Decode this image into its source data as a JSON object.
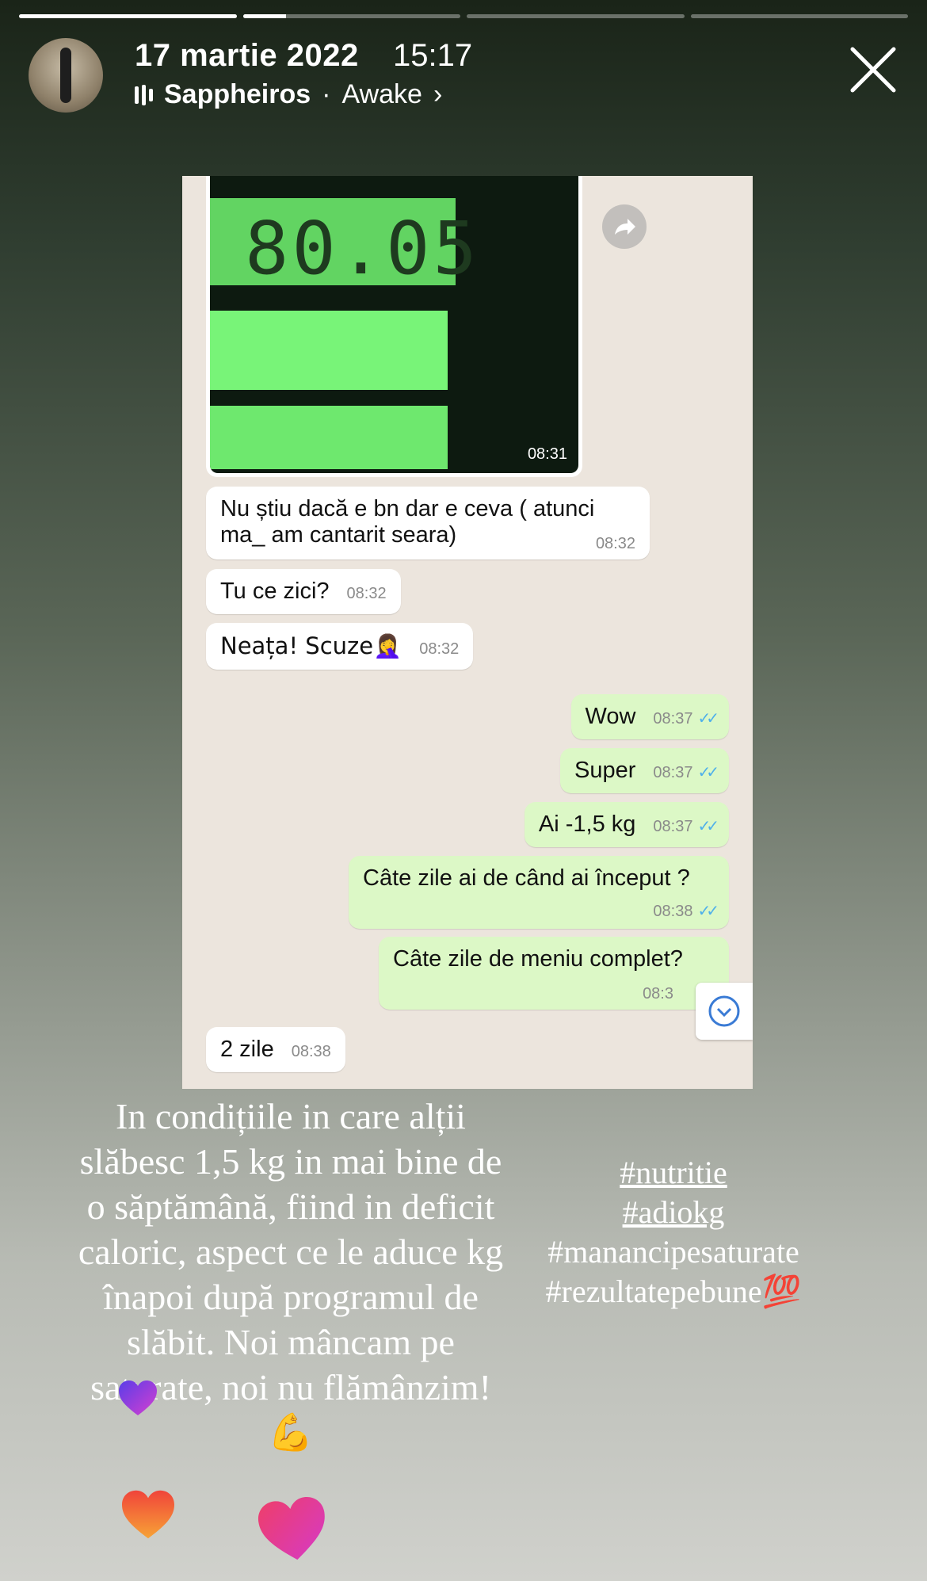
{
  "story": {
    "segments": [
      1,
      0.2,
      0,
      0
    ],
    "date": "17 martie 2022",
    "time": "15:17",
    "artist": "Sappheiros",
    "separator": "·",
    "song": "Awake",
    "chevron": "›"
  },
  "chat": {
    "scale_reading": "80.05",
    "photo_time": "08:31",
    "messages": [
      {
        "text": "Nu știu dacă e bn dar e ceva ( atunci ma_ am cantarit seara)",
        "time": "08:32",
        "dir": "in"
      },
      {
        "text": "Tu ce zici?",
        "time": "08:32",
        "dir": "in"
      },
      {
        "text": "Neața! Scuze🤦‍♀️",
        "time": "08:32",
        "dir": "in"
      },
      {
        "text": "Wow",
        "time": "08:37",
        "dir": "out"
      },
      {
        "text": "Super",
        "time": "08:37",
        "dir": "out"
      },
      {
        "text": "Ai -1,5 kg",
        "time": "08:37",
        "dir": "out"
      },
      {
        "text": "Câte zile ai de când ai început ?",
        "time": "08:38",
        "dir": "out"
      },
      {
        "text": "Câte zile de meniu complet?",
        "time": "08:3",
        "dir": "out"
      },
      {
        "text": "2 zile",
        "time": "08:38",
        "dir": "in"
      }
    ],
    "read_tick": "✓✓"
  },
  "caption": {
    "text": "In condițiile in care alții slăbesc 1,5 kg in mai bine de o săptămână, fiind in deficit caloric, aspect ce le aduce kg înapoi după programul de slăbit. Noi mâncam pe saturate, noi nu flămânzim!",
    "emoji": "💪"
  },
  "hashtags": [
    "#nutritie",
    "#adiokg",
    "#manancipesaturate",
    "#rezultatepebune💯"
  ],
  "colors": {
    "bubble_out": "#dcf8c6",
    "bubble_in": "#ffffff",
    "tick": "#4fb0ea",
    "lcd": "#62d462"
  }
}
